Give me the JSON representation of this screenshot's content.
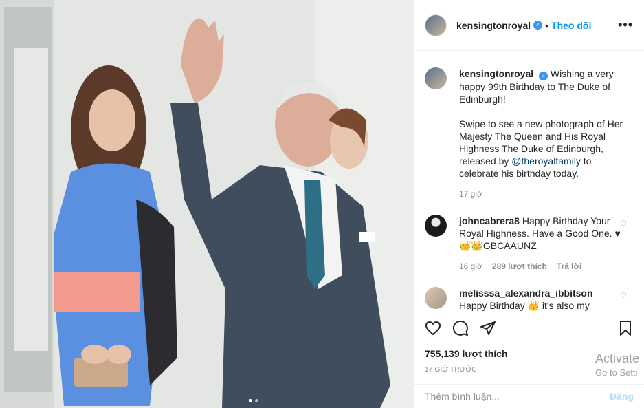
{
  "post": {
    "username": "kensingtonroyal",
    "verified_mark": "✓",
    "follow_label": "Theo dõi",
    "separator": "•",
    "more_label": "•••"
  },
  "caption": {
    "username": "kensingtonroyal",
    "text_1": "Wishing a very happy 99th Birthday to The Duke of Edinburgh!",
    "text_2": "Swipe to see a new photograph of Her Majesty The Queen and His Royal Highness The Duke of Edinburgh, released by ",
    "mention": "@theroyalfamily",
    "text_3": " to celebrate his birthday today.",
    "time": "17 giờ"
  },
  "comments": [
    {
      "username": "johncabrera8",
      "text": "Happy Birthday Your Royal Highness. Have a Good One. ♥👑👑GBCAAUNZ",
      "time": "16 giờ",
      "likes": "289 lượt thích",
      "reply": "Trả lời"
    },
    {
      "username": "melisssa_alexandra_ibbitson",
      "text": "Happy Birthday 👑 it's also my"
    }
  ],
  "actions": {
    "like_icon": "heart-icon",
    "comment_icon": "comment-icon",
    "share_icon": "paper-plane-icon",
    "save_icon": "bookmark-icon",
    "likes_count": "755,139 lượt thích",
    "timestamp": "17 GIỜ TRƯỚC"
  },
  "add_comment": {
    "placeholder": "Thêm bình luận...",
    "post_label": "Đăng"
  },
  "watermark": {
    "line1": "Activate",
    "line2": "Go to Setti"
  },
  "carousel": {
    "next_icon": "›"
  },
  "colors": {
    "accent": "#0095f6",
    "verified": "#3897f0",
    "muted": "#8e8e8e",
    "post_disabled": "#b2dffc"
  }
}
